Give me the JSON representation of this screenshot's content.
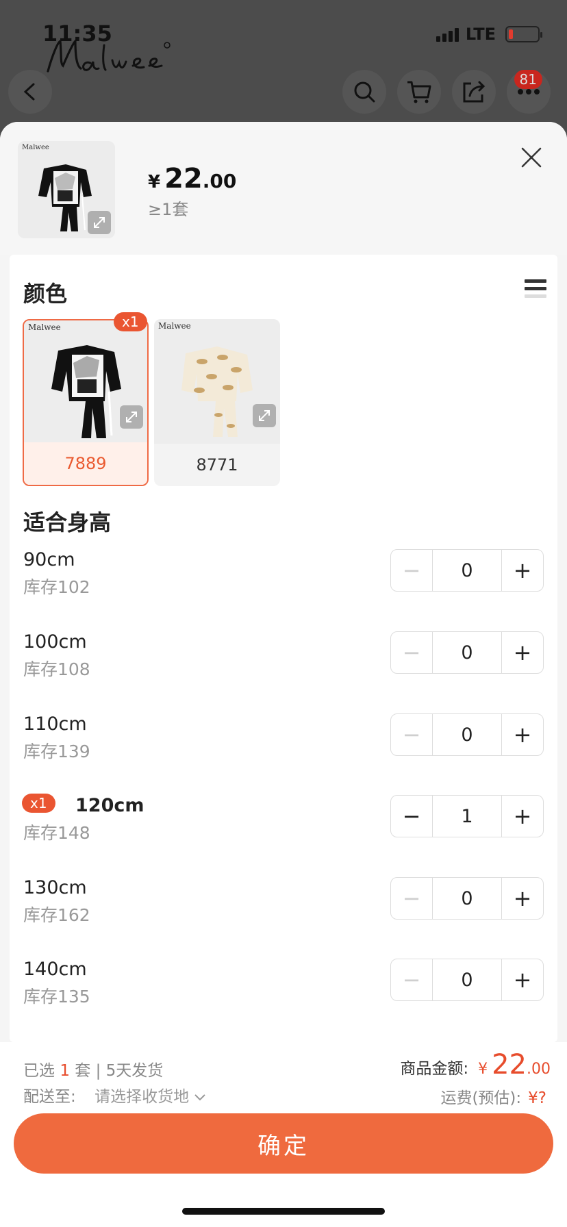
{
  "status": {
    "time": "11:35",
    "network": "LTE"
  },
  "header": {
    "brand": "Malwee",
    "cart_badge": "81"
  },
  "product": {
    "currency": "¥",
    "price_int": "22",
    "price_dec": ".00",
    "min_qty": "≥1套"
  },
  "colors": {
    "title": "颜色",
    "items": [
      {
        "label": "7889",
        "selected": true,
        "count_badge": "x1"
      },
      {
        "label": "8771",
        "selected": false
      }
    ]
  },
  "sizes": {
    "title": "适合身高",
    "items": [
      {
        "size": "90cm",
        "stock": "库存102",
        "qty": "0"
      },
      {
        "size": "100cm",
        "stock": "库存108",
        "qty": "0"
      },
      {
        "size": "110cm",
        "stock": "库存139",
        "qty": "0"
      },
      {
        "size": "120cm",
        "stock": "库存148",
        "qty": "1",
        "badge": "x1"
      },
      {
        "size": "130cm",
        "stock": "库存162",
        "qty": "0"
      },
      {
        "size": "140cm",
        "stock": "库存135",
        "qty": "0"
      }
    ]
  },
  "footer": {
    "selected_prefix": "已选",
    "selected_count": "1",
    "selected_suffix": "套 | 5天发货",
    "ship_label": "配送至:",
    "ship_value": "请选择收货地",
    "amount_label": "商品金额:",
    "amount_cur": "¥",
    "amount_int": "22",
    "amount_dec": ".00",
    "freight_label": "运费(预估):",
    "freight_value": "¥?",
    "confirm_label": "确定"
  },
  "colors_theme": {
    "accent": "#ef6a3e",
    "price_red": "#e74c2c"
  }
}
